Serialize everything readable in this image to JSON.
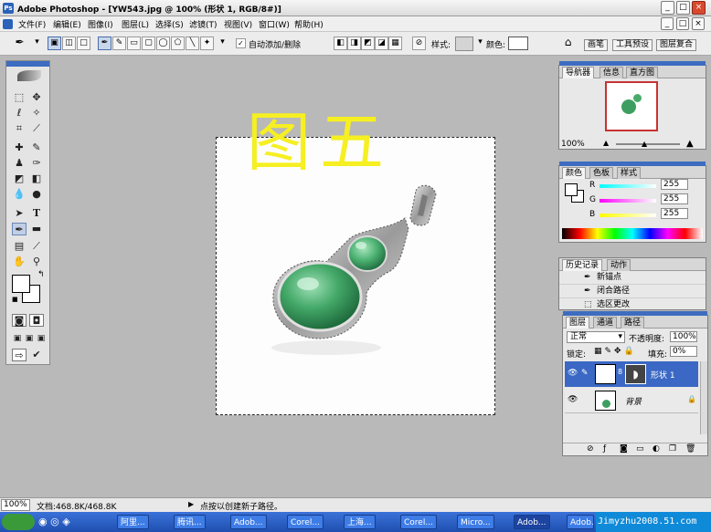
{
  "window": {
    "title": "Adobe Photoshop - [YW543.jpg @ 100% (形状 1, RGB/8#)]",
    "btn_min": "_",
    "btn_max": "□",
    "btn_close": "×",
    "doc_min": "_",
    "doc_max": "□",
    "doc_close": "×"
  },
  "menu": [
    "文件(F)",
    "编辑(E)",
    "图像(I)",
    "图层(L)",
    "选择(S)",
    "滤镜(T)",
    "视图(V)",
    "窗口(W)",
    "帮助(H)"
  ],
  "options": {
    "auto_add_delete": "自动添加/删除",
    "style_label": "样式:",
    "color_label": "颜色:",
    "tabs": [
      "画笔",
      "工具预设",
      "图层复合"
    ]
  },
  "canvas": {
    "overlay_text": "图五"
  },
  "navigator": {
    "tabs": [
      "导航器",
      "信息",
      "直方图"
    ],
    "zoom": "100%"
  },
  "color": {
    "tabs": [
      "颜色",
      "色板",
      "样式"
    ],
    "r_label": "R",
    "g_label": "G",
    "b_label": "B",
    "r": "255",
    "g": "255",
    "b": "255"
  },
  "history": {
    "tabs": [
      "历史记录",
      "动作"
    ],
    "items": [
      "新锚点",
      "闭合路径",
      "选区更改"
    ]
  },
  "layers": {
    "tabs": [
      "图层",
      "通道",
      "路径"
    ],
    "mode": "正常",
    "opacity_label": "不透明度:",
    "opacity": "100%",
    "lock_label": "锁定:",
    "fill_label": "填充:",
    "fill": "0%",
    "layer1": "形状 1",
    "layer2": "背景"
  },
  "status": {
    "zoom": "100%",
    "doc": "文档:468.8K/468.8K",
    "hint": "点按以创建新子路径。"
  },
  "taskbar": {
    "items": [
      "阿里...",
      "腾讯...",
      "Adob...",
      "Corel...",
      "上海...",
      "Corel...",
      "Micro...",
      "Adob...",
      "Adob..."
    ],
    "watermark": "Jimyzhu2008.51.com"
  }
}
